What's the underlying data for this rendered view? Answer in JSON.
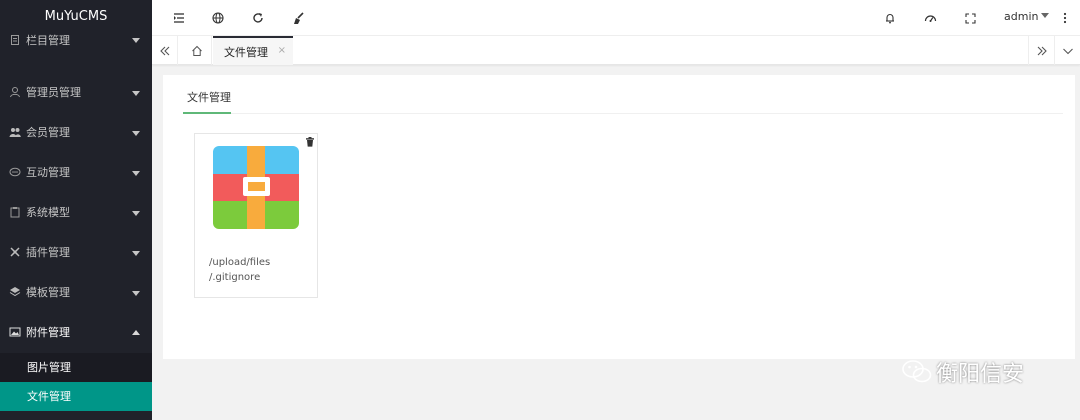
{
  "sidebar": {
    "logo": "MuYuCMS",
    "items": [
      {
        "label": "栏目管理",
        "icon": "doc-icon"
      },
      {
        "label": "管理员管理",
        "icon": "user-icon"
      },
      {
        "label": "会员管理",
        "icon": "users-icon"
      },
      {
        "label": "互动管理",
        "icon": "chat-icon"
      },
      {
        "label": "系统模型",
        "icon": "clipboard-icon"
      },
      {
        "label": "插件管理",
        "icon": "plugin-icon"
      },
      {
        "label": "模板管理",
        "icon": "layers-icon"
      },
      {
        "label": "附件管理",
        "icon": "image-icon"
      }
    ],
    "subitems": [
      {
        "label": "图片管理"
      },
      {
        "label": "文件管理"
      }
    ]
  },
  "header": {
    "user": "admin",
    "icons": [
      "menu-fold-icon",
      "globe-icon",
      "refresh-icon",
      "clean-icon",
      "bell-icon",
      "theme-icon",
      "fullscreen-icon",
      "more-icon"
    ]
  },
  "tabs": {
    "active_label": "文件管理",
    "close_glyph": "×"
  },
  "content": {
    "tab_label": "文件管理",
    "file": {
      "line1": "/upload/files",
      "line2": "/.gitignore"
    }
  },
  "watermark": "衡阳信安",
  "colors": {
    "sidebar_bg": "#20222a",
    "active_accent": "#009688",
    "tab_underline": "#5fb878"
  }
}
